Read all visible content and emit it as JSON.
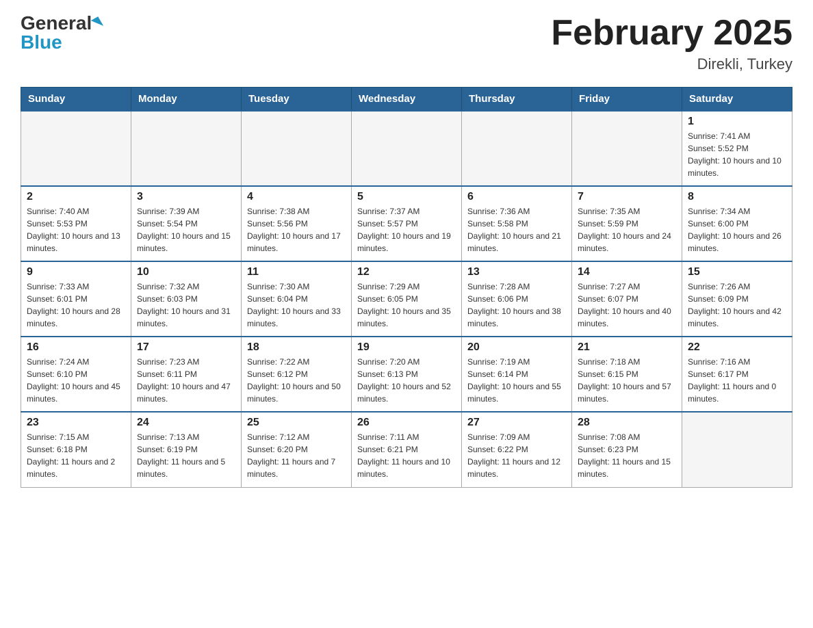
{
  "header": {
    "logo_general": "General",
    "logo_blue": "Blue",
    "title": "February 2025",
    "location": "Direkli, Turkey"
  },
  "days_of_week": [
    "Sunday",
    "Monday",
    "Tuesday",
    "Wednesday",
    "Thursday",
    "Friday",
    "Saturday"
  ],
  "weeks": [
    [
      {
        "day": "",
        "sunrise": "",
        "sunset": "",
        "daylight": "",
        "empty": true
      },
      {
        "day": "",
        "sunrise": "",
        "sunset": "",
        "daylight": "",
        "empty": true
      },
      {
        "day": "",
        "sunrise": "",
        "sunset": "",
        "daylight": "",
        "empty": true
      },
      {
        "day": "",
        "sunrise": "",
        "sunset": "",
        "daylight": "",
        "empty": true
      },
      {
        "day": "",
        "sunrise": "",
        "sunset": "",
        "daylight": "",
        "empty": true
      },
      {
        "day": "",
        "sunrise": "",
        "sunset": "",
        "daylight": "",
        "empty": true
      },
      {
        "day": "1",
        "sunrise": "Sunrise: 7:41 AM",
        "sunset": "Sunset: 5:52 PM",
        "daylight": "Daylight: 10 hours and 10 minutes.",
        "empty": false
      }
    ],
    [
      {
        "day": "2",
        "sunrise": "Sunrise: 7:40 AM",
        "sunset": "Sunset: 5:53 PM",
        "daylight": "Daylight: 10 hours and 13 minutes.",
        "empty": false
      },
      {
        "day": "3",
        "sunrise": "Sunrise: 7:39 AM",
        "sunset": "Sunset: 5:54 PM",
        "daylight": "Daylight: 10 hours and 15 minutes.",
        "empty": false
      },
      {
        "day": "4",
        "sunrise": "Sunrise: 7:38 AM",
        "sunset": "Sunset: 5:56 PM",
        "daylight": "Daylight: 10 hours and 17 minutes.",
        "empty": false
      },
      {
        "day": "5",
        "sunrise": "Sunrise: 7:37 AM",
        "sunset": "Sunset: 5:57 PM",
        "daylight": "Daylight: 10 hours and 19 minutes.",
        "empty": false
      },
      {
        "day": "6",
        "sunrise": "Sunrise: 7:36 AM",
        "sunset": "Sunset: 5:58 PM",
        "daylight": "Daylight: 10 hours and 21 minutes.",
        "empty": false
      },
      {
        "day": "7",
        "sunrise": "Sunrise: 7:35 AM",
        "sunset": "Sunset: 5:59 PM",
        "daylight": "Daylight: 10 hours and 24 minutes.",
        "empty": false
      },
      {
        "day": "8",
        "sunrise": "Sunrise: 7:34 AM",
        "sunset": "Sunset: 6:00 PM",
        "daylight": "Daylight: 10 hours and 26 minutes.",
        "empty": false
      }
    ],
    [
      {
        "day": "9",
        "sunrise": "Sunrise: 7:33 AM",
        "sunset": "Sunset: 6:01 PM",
        "daylight": "Daylight: 10 hours and 28 minutes.",
        "empty": false
      },
      {
        "day": "10",
        "sunrise": "Sunrise: 7:32 AM",
        "sunset": "Sunset: 6:03 PM",
        "daylight": "Daylight: 10 hours and 31 minutes.",
        "empty": false
      },
      {
        "day": "11",
        "sunrise": "Sunrise: 7:30 AM",
        "sunset": "Sunset: 6:04 PM",
        "daylight": "Daylight: 10 hours and 33 minutes.",
        "empty": false
      },
      {
        "day": "12",
        "sunrise": "Sunrise: 7:29 AM",
        "sunset": "Sunset: 6:05 PM",
        "daylight": "Daylight: 10 hours and 35 minutes.",
        "empty": false
      },
      {
        "day": "13",
        "sunrise": "Sunrise: 7:28 AM",
        "sunset": "Sunset: 6:06 PM",
        "daylight": "Daylight: 10 hours and 38 minutes.",
        "empty": false
      },
      {
        "day": "14",
        "sunrise": "Sunrise: 7:27 AM",
        "sunset": "Sunset: 6:07 PM",
        "daylight": "Daylight: 10 hours and 40 minutes.",
        "empty": false
      },
      {
        "day": "15",
        "sunrise": "Sunrise: 7:26 AM",
        "sunset": "Sunset: 6:09 PM",
        "daylight": "Daylight: 10 hours and 42 minutes.",
        "empty": false
      }
    ],
    [
      {
        "day": "16",
        "sunrise": "Sunrise: 7:24 AM",
        "sunset": "Sunset: 6:10 PM",
        "daylight": "Daylight: 10 hours and 45 minutes.",
        "empty": false
      },
      {
        "day": "17",
        "sunrise": "Sunrise: 7:23 AM",
        "sunset": "Sunset: 6:11 PM",
        "daylight": "Daylight: 10 hours and 47 minutes.",
        "empty": false
      },
      {
        "day": "18",
        "sunrise": "Sunrise: 7:22 AM",
        "sunset": "Sunset: 6:12 PM",
        "daylight": "Daylight: 10 hours and 50 minutes.",
        "empty": false
      },
      {
        "day": "19",
        "sunrise": "Sunrise: 7:20 AM",
        "sunset": "Sunset: 6:13 PM",
        "daylight": "Daylight: 10 hours and 52 minutes.",
        "empty": false
      },
      {
        "day": "20",
        "sunrise": "Sunrise: 7:19 AM",
        "sunset": "Sunset: 6:14 PM",
        "daylight": "Daylight: 10 hours and 55 minutes.",
        "empty": false
      },
      {
        "day": "21",
        "sunrise": "Sunrise: 7:18 AM",
        "sunset": "Sunset: 6:15 PM",
        "daylight": "Daylight: 10 hours and 57 minutes.",
        "empty": false
      },
      {
        "day": "22",
        "sunrise": "Sunrise: 7:16 AM",
        "sunset": "Sunset: 6:17 PM",
        "daylight": "Daylight: 11 hours and 0 minutes.",
        "empty": false
      }
    ],
    [
      {
        "day": "23",
        "sunrise": "Sunrise: 7:15 AM",
        "sunset": "Sunset: 6:18 PM",
        "daylight": "Daylight: 11 hours and 2 minutes.",
        "empty": false
      },
      {
        "day": "24",
        "sunrise": "Sunrise: 7:13 AM",
        "sunset": "Sunset: 6:19 PM",
        "daylight": "Daylight: 11 hours and 5 minutes.",
        "empty": false
      },
      {
        "day": "25",
        "sunrise": "Sunrise: 7:12 AM",
        "sunset": "Sunset: 6:20 PM",
        "daylight": "Daylight: 11 hours and 7 minutes.",
        "empty": false
      },
      {
        "day": "26",
        "sunrise": "Sunrise: 7:11 AM",
        "sunset": "Sunset: 6:21 PM",
        "daylight": "Daylight: 11 hours and 10 minutes.",
        "empty": false
      },
      {
        "day": "27",
        "sunrise": "Sunrise: 7:09 AM",
        "sunset": "Sunset: 6:22 PM",
        "daylight": "Daylight: 11 hours and 12 minutes.",
        "empty": false
      },
      {
        "day": "28",
        "sunrise": "Sunrise: 7:08 AM",
        "sunset": "Sunset: 6:23 PM",
        "daylight": "Daylight: 11 hours and 15 minutes.",
        "empty": false
      },
      {
        "day": "",
        "sunrise": "",
        "sunset": "",
        "daylight": "",
        "empty": true
      }
    ]
  ]
}
